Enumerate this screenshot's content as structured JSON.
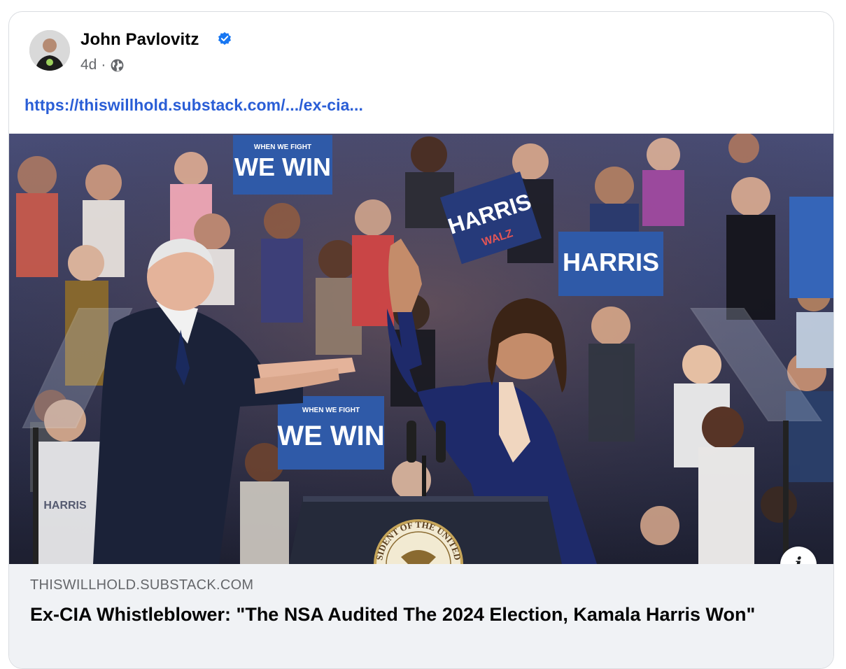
{
  "post": {
    "author_name": "John Pavlovitz",
    "verified": true,
    "time_ago": "4d",
    "separator": "·",
    "audience_icon": "globe-icon",
    "link_text": "https://thiswillhold.substack.com/.../ex-cia..."
  },
  "photo": {
    "signs": {
      "we_win_small": "WHEN WE FIGHT",
      "we_win_big": "WE WIN",
      "harris": "HARRIS",
      "walz": "WALZ",
      "harris_shirt": "HARRIS",
      "seal_text": "SIDENT OF THE UNITED"
    }
  },
  "preview": {
    "domain": "THISWILLHOLD.SUBSTACK.COM",
    "headline": "Ex-CIA Whistleblower: \"The NSA Audited The 2024 Election, Kamala Harris Won\"",
    "info_label": "i"
  },
  "colors": {
    "link": "#2a5ed6",
    "verified": "#1877f2",
    "preview_bg": "#f0f2f5",
    "secondary_text": "#65676b"
  }
}
